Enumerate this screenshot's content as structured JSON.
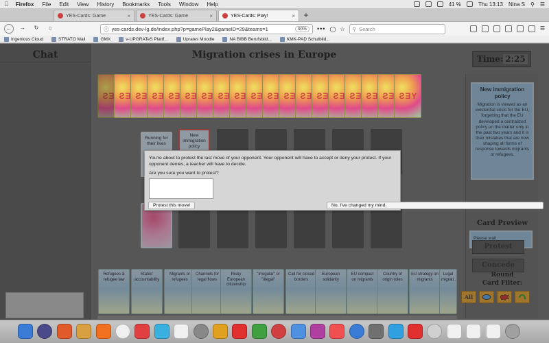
{
  "menubar": {
    "app": "Firefox",
    "items": [
      "File",
      "Edit",
      "View",
      "History",
      "Bookmarks",
      "Tools",
      "Window",
      "Help"
    ],
    "battery": "41 %",
    "clock": "Thu 13:13",
    "user": "Nina S"
  },
  "browser": {
    "tabs": [
      {
        "title": "YES-Cards: Game",
        "active": false
      },
      {
        "title": "YES-Cards: Game",
        "active": false
      },
      {
        "title": "YES-Cards: Play!",
        "active": true
      }
    ],
    "new_tab": "+",
    "url": "yes-cards.dev-lg.de/index.php?p=gamePlay2&gameID=29&teams=1",
    "zoom": "90%",
    "more": "•••",
    "search_placeholder": "Search",
    "bookmarks": [
      "Ingenious Cloud",
      "STRATO Mail",
      "GMX",
      "v-UPGRATeS Plattf...",
      "Uprates Moodle",
      "NA BIBB Berufsbild...",
      "KMK-PAD Schulbild..."
    ]
  },
  "game": {
    "chat_title": "Chat",
    "title": "Migration crises in Europe",
    "deck_label": "YES",
    "board_row1": [
      "Running for their lives",
      "New immigration policy",
      "",
      "",
      "",
      "",
      "",
      ""
    ],
    "hand_cards": [
      "Refugees & refugee law",
      "States' accountability",
      "Migrants or refugees",
      "Channels for legal flows",
      "Risky European citizenship",
      "\"Irregular\" or \"illegal\"",
      "Call for closed borders",
      "European solidarity",
      "EU compact on migrants",
      "Country of origin roles",
      "EU strategy on migrants",
      "Legal migrati..."
    ]
  },
  "sidebar": {
    "time_label": "Time:",
    "time_value": "2:25",
    "situation_title": "New immigration policy",
    "situation_text": "Migration is viewed as an existential crisis for the EU, forgetting that the EU developed a centralized policy on the matter only in the past two years and it is their mistakes that are now shaping all forms of response towards migrants or refugees.",
    "preview_title": "Card Preview",
    "preview_text": "Please wait.",
    "protest_label": "Protest",
    "concede_label": "Concede",
    "round_label": "Round",
    "filter_label": "Card Filter:",
    "filter_all": "All"
  },
  "dialog": {
    "message": "You're about to protest the last move of your opponent. Your opponent will have to accept or deny your protest. If your opponent denies, a teacher will have to decide.",
    "question": "Are you sure you want to protest?",
    "input_value": "",
    "confirm_label": "Protest this move!",
    "cancel_label": "No, I've changed my mind."
  }
}
